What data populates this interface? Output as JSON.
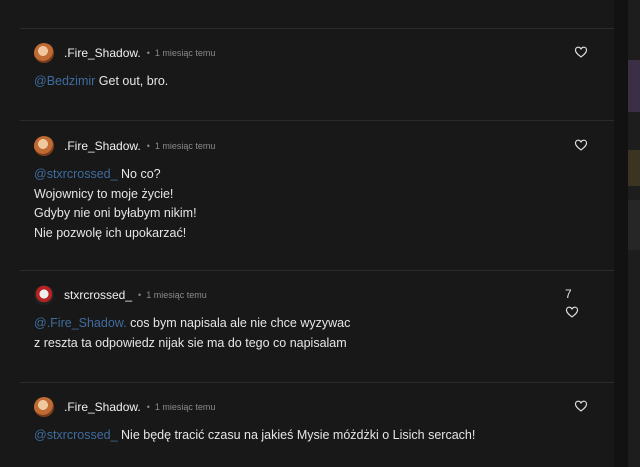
{
  "comments": [
    {
      "author": ".Fire_Shadow.",
      "time": "1 miesiąc temu",
      "mention": "@Bedzimir",
      "text": "Get out, bro."
    },
    {
      "author": ".Fire_Shadow.",
      "time": "1 miesiąc temu",
      "mention": "@stxrcrossed_",
      "text": "No co?\nWojownicy to moje życie!\nGdyby nie oni byłabym nikim!\nNie pozwolę ich upokarzać!"
    },
    {
      "author": "stxrcrossed_",
      "time": "1 miesiąc temu",
      "mention": "@.Fire_Shadow.",
      "text": "cos bym napisala ale nie chce wyzywac\nz reszta ta odpowiedz nijak sie ma do tego co napisalam",
      "likes": "7"
    },
    {
      "author": ".Fire_Shadow.",
      "time": "1 miesiąc temu",
      "mention": "@stxrcrossed_",
      "text": "Nie będę tracić czasu na jakieś Mysie móżdżki o Lisich sercach!"
    }
  ],
  "separator": "•",
  "icons": {
    "like": "heart-icon"
  },
  "colors": {
    "mention": "#3f6c9e",
    "background": "#181818"
  }
}
